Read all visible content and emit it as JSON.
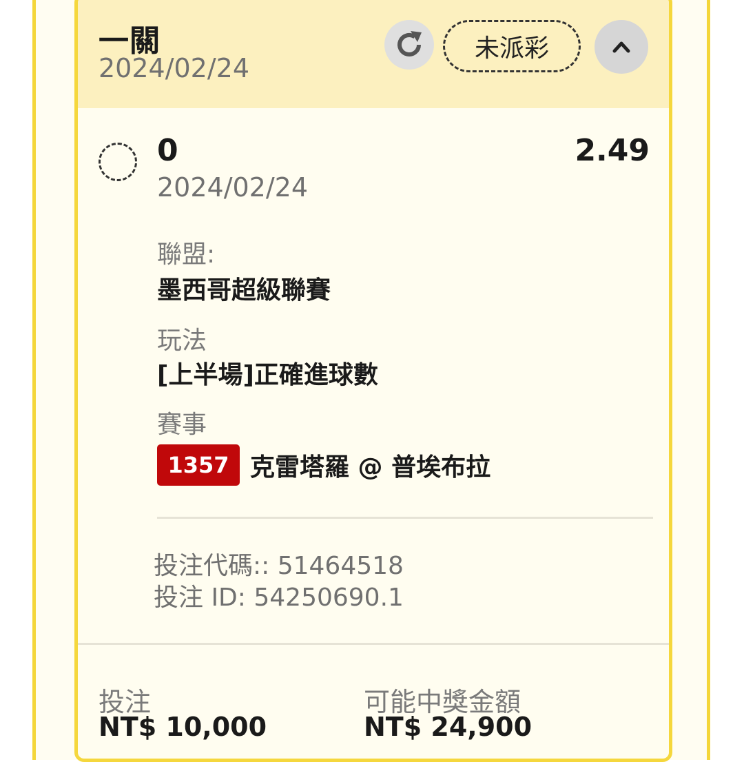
{
  "header": {
    "bet_type": "一關",
    "date": "2024/02/24",
    "status": "未派彩"
  },
  "icons": {
    "refresh": "refresh-icon",
    "collapse": "chevron-up-icon",
    "selection": "dashed-circle-icon"
  },
  "selection": {
    "name": "0",
    "odds": "2.49",
    "date": "2024/02/24"
  },
  "details": {
    "league_label": "聯盟:",
    "league_value": "墨西哥超級聯賽",
    "market_label": "玩法",
    "market_value": "[上半場]正確進球數",
    "event_label": "賽事",
    "event_id": "1357",
    "event_name": "克雷塔羅 @ 普埃布拉"
  },
  "refs": {
    "bet_code": "投注代碼:: 51464518",
    "bet_id": "投注 ID: 54250690.1"
  },
  "footer": {
    "stake_label": "投注",
    "stake_value": "NT$ 10,000",
    "payout_label": "可能中獎金額",
    "payout_value": "NT$ 24,900"
  },
  "colors": {
    "card_border": "#f5d73d",
    "header_bg": "#fcf0bf",
    "card_bg": "#fffdf0",
    "event_badge": "#c0080a"
  }
}
